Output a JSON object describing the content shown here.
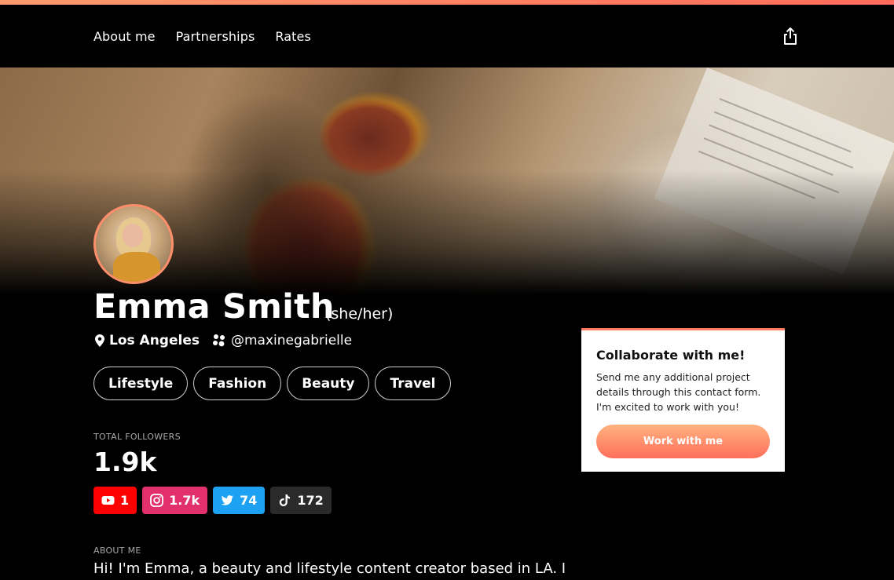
{
  "nav": {
    "links": [
      {
        "label": "About me"
      },
      {
        "label": "Partnerships"
      },
      {
        "label": "Rates"
      }
    ],
    "share_icon": "share-icon"
  },
  "profile": {
    "name": "Emma Smith",
    "pronouns": "(she/her)",
    "location": "Los Angeles",
    "handle": "@maxinegabrielle",
    "tags": [
      "Lifestyle",
      "Fashion",
      "Beauty",
      "Travel"
    ]
  },
  "followers": {
    "label": "TOTAL FOLLOWERS",
    "total": "1.9k",
    "platforms": [
      {
        "icon": "youtube-icon",
        "count": "1",
        "color": "#ff0000"
      },
      {
        "icon": "instagram-icon",
        "count": "1.7k",
        "color": "#e1306c"
      },
      {
        "icon": "twitter-icon",
        "count": "74",
        "color": "#1da1f2"
      },
      {
        "icon": "tiktok-icon",
        "count": "172",
        "color": "#2a2a2a"
      }
    ]
  },
  "about": {
    "label": "ABOUT ME",
    "text": "Hi! I'm Emma, a beauty and lifestyle content creator based in LA. I"
  },
  "collab": {
    "title": "Collaborate with me!",
    "description": "Send me any additional project details through this contact form. I'm excited to work with you!",
    "button_label": "Work with me"
  },
  "colors": {
    "accent": "#ff7a5f",
    "accent_light": "#ffb27f"
  }
}
